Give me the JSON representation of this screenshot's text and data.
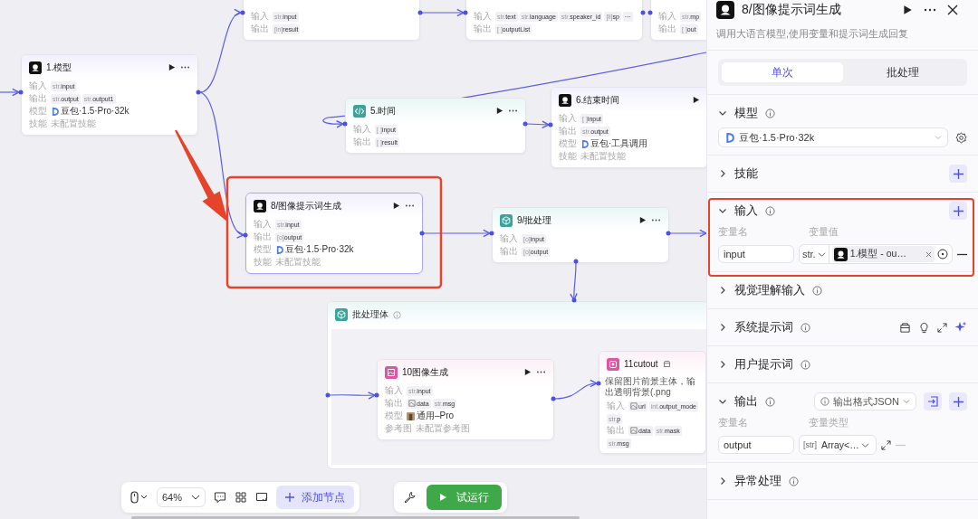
{
  "canvas": {
    "nodes": [
      {
        "title": "1.模型",
        "selected": false,
        "rows": [
          {
            "label": "输入",
            "kind": "tags",
            "tags": [
              {
                "kind": "typed",
                "type": "str.",
                "name": "input"
              }
            ]
          },
          {
            "label": "输出",
            "kind": "tags",
            "tags": [
              {
                "kind": "typed",
                "type": "str.",
                "name": "output"
              },
              {
                "kind": "typed",
                "type": "str.",
                "name": "output1"
              }
            ]
          },
          {
            "label": "模型",
            "kind": "model",
            "text": "豆包·1.5·Pro·32k"
          },
          {
            "label": "技能",
            "kind": "note",
            "text": "未配置技能"
          }
        ]
      },
      {
        "selected": false,
        "rows": [
          {
            "label": "输入",
            "kind": "tags",
            "tags": [
              {
                "kind": "typed",
                "type": "str.",
                "name": "input"
              }
            ]
          },
          {
            "label": "输出",
            "kind": "tags",
            "tags": [
              {
                "kind": "typed",
                "type": "[in]",
                "name": "result"
              }
            ]
          }
        ]
      },
      {
        "title": "8/图像提示词生成",
        "selected": true,
        "rows": [
          {
            "label": "输入",
            "kind": "tags",
            "tags": [
              {
                "kind": "typed",
                "type": "str.",
                "name": "input"
              }
            ]
          },
          {
            "label": "输出",
            "kind": "tags",
            "tags": [
              {
                "kind": "typed",
                "type": "[o]",
                "name": "output"
              }
            ]
          },
          {
            "label": "模型",
            "kind": "model",
            "text": "豆包·1.5·Pro·32k"
          },
          {
            "label": "技能",
            "kind": "note",
            "text": "未配置技能"
          }
        ]
      },
      {
        "title": "5.时间",
        "selected": false,
        "rows": [
          {
            "label": "输入",
            "kind": "tags",
            "tags": [
              {
                "kind": "typed",
                "type": "[ ]",
                "name": "input"
              }
            ]
          },
          {
            "label": "输出",
            "kind": "tags",
            "tags": [
              {
                "kind": "typed",
                "type": "[ ]",
                "name": "result"
              }
            ]
          }
        ]
      },
      {
        "selected": false,
        "rows": [
          {
            "label": "输入",
            "kind": "tags",
            "tags": [
              {
                "kind": "typed",
                "type": "str.",
                "name": "text"
              },
              {
                "kind": "typed",
                "type": "str.",
                "name": "language"
              },
              {
                "kind": "typed",
                "type": "str.",
                "name": "speaker_id"
              },
              {
                "kind": "typed",
                "type": "[li]",
                "name": "sp"
              }
            ],
            "more": "···"
          },
          {
            "label": "输出",
            "kind": "tags",
            "tags": [
              {
                "kind": "typed",
                "type": "[ ]",
                "name": "outputList"
              }
            ]
          }
        ]
      },
      {
        "title": "9/批处理",
        "selected": false,
        "rows": [
          {
            "label": "输入",
            "kind": "tags",
            "tags": [
              {
                "kind": "typed",
                "type": "[o]",
                "name": "input"
              }
            ]
          },
          {
            "label": "输出",
            "kind": "tags",
            "tags": [
              {
                "kind": "typed",
                "type": "[o]",
                "name": "output"
              }
            ]
          }
        ]
      },
      {
        "title": "6.结束时间",
        "selected": false,
        "rows": [
          {
            "label": "输入",
            "kind": "tags",
            "tags": [
              {
                "kind": "typed",
                "type": "[ ]",
                "name": "input"
              }
            ]
          },
          {
            "label": "输出",
            "kind": "tags",
            "tags": [
              {
                "kind": "typed",
                "type": "str.",
                "name": "output"
              }
            ]
          },
          {
            "label": "模型",
            "kind": "model",
            "text": "豆包·工具调用"
          },
          {
            "label": "技能",
            "kind": "note",
            "text": "未配置技能"
          }
        ]
      },
      {
        "selected": false,
        "rows": [
          {
            "label": "输入",
            "kind": "tags",
            "tags": [
              {
                "kind": "typed",
                "type": "str.",
                "name": "mp"
              }
            ]
          },
          {
            "label": "输出",
            "kind": "tags",
            "tags": [
              {
                "kind": "typed",
                "type": "[ ]",
                "name": "out"
              }
            ]
          }
        ]
      }
    ],
    "group": {
      "title": "批处理体",
      "nodes": [
        {
          "title": "10图像生成",
          "selected": false,
          "rows": [
            {
              "label": "输入",
              "kind": "tags",
              "tags": [
                {
                  "kind": "typed",
                  "type": "str.",
                  "name": "input"
                }
              ]
            },
            {
              "label": "输出",
              "kind": "tags",
              "tags": [
                {
                  "kind": "image",
                  "name": "data"
                },
                {
                  "kind": "typed",
                  "type": "str.",
                  "name": "msg"
                }
              ]
            },
            {
              "label": "模型",
              "kind": "preset",
              "text": "通用–Pro"
            },
            {
              "label": "参考图",
              "kind": "note",
              "text": "未配置参考图"
            }
          ]
        },
        {
          "title": "11cutout",
          "selected": false,
          "description": "保留图片前景主体，输出透明背景(.png",
          "rows": [
            {
              "label": "输入",
              "kind": "tags",
              "tags": [
                {
                  "kind": "image",
                  "name": "url"
                },
                {
                  "kind": "typed",
                  "type": "int.",
                  "name": "output_mode"
                },
                {
                  "kind": "typed",
                  "type": "str.",
                  "name": "p"
                }
              ]
            },
            {
              "label": "输出",
              "kind": "tags",
              "tags": [
                {
                  "kind": "image",
                  "name": "data"
                },
                {
                  "kind": "typed",
                  "type": "str.",
                  "name": "mask"
                },
                {
                  "kind": "typed",
                  "type": "str.",
                  "name": "msg"
                }
              ]
            }
          ]
        }
      ]
    }
  },
  "toolbar": {
    "zoom": "64%",
    "add_node": "添加节点",
    "run": "试运行"
  },
  "panel": {
    "title": "8/图像提示词生成",
    "description": "调用大语言模型,使用变量和提示词生成回复",
    "tabs": [
      {
        "label": "单次",
        "selected": true
      },
      {
        "label": "批处理",
        "selected": false
      }
    ],
    "sections": [
      {
        "kind": "model",
        "title": "模型",
        "expanded": true,
        "info": true,
        "add": false,
        "model": "豆包·1.5·Pro·32k"
      },
      {
        "kind": "plain",
        "title": "技能",
        "expanded": false,
        "info": false,
        "add": true
      },
      {
        "kind": "inputs",
        "title": "输入",
        "expanded": true,
        "info": true,
        "add": true,
        "columns": [
          "变量名",
          "变量值"
        ],
        "rows": [
          {
            "name": "input",
            "type": "str.",
            "ref": "1.模型 - ou…",
            "removable": true
          }
        ]
      },
      {
        "kind": "plain",
        "title": "视觉理解输入",
        "expanded": false,
        "info": true,
        "add": false
      },
      {
        "kind": "prompt",
        "title": "系统提示词",
        "expanded": false,
        "info": true,
        "add": false
      },
      {
        "kind": "plain",
        "title": "用户提示词",
        "expanded": false,
        "info": true,
        "add": false
      },
      {
        "kind": "outputs",
        "title": "输出",
        "expanded": true,
        "info": true,
        "add": true,
        "format": "输出格式JSON",
        "columns": [
          "变量名",
          "变量类型"
        ],
        "rows": [
          {
            "name": "output",
            "type_prefix": "[str]",
            "type": "Array<…",
            "removable": false
          }
        ]
      },
      {
        "kind": "plain",
        "title": "异常处理",
        "expanded": false,
        "info": true,
        "add": false
      }
    ]
  }
}
